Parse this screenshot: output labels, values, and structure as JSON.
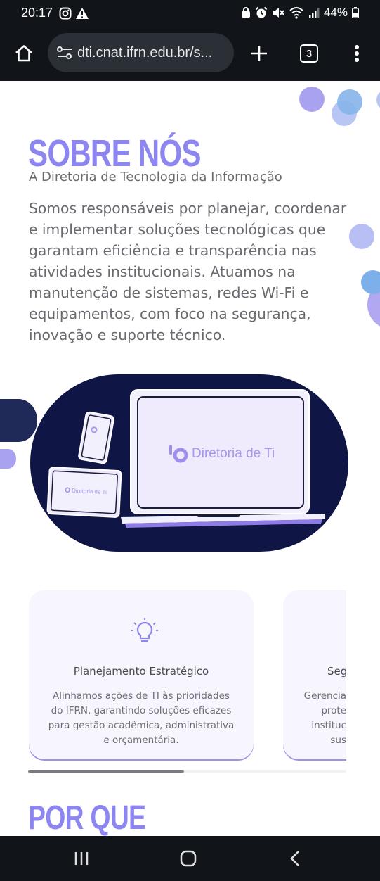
{
  "status_bar": {
    "time": "20:17",
    "battery": "44%"
  },
  "browser": {
    "url": "dti.cnat.ifrn.edu.br/s...",
    "tab_count": "3"
  },
  "about": {
    "title": "SOBRE NÓS",
    "subtitle": "A Diretoria de Tecnologia da Informação",
    "lines": [
      "Somos responsáveis por planejar, coordenar",
      "e implementar soluções tecnológicas que",
      "garantam eficiência e transparência nas",
      "atividades institucionais. Atuamos na",
      "manutenção de sistemas, redes Wi-Fi e",
      "equipamentos, com foco na segurança,",
      "inovação e suporte técnico."
    ]
  },
  "hero": {
    "brand": "Diretoria de Ti"
  },
  "cards": [
    {
      "title": "Planejamento Estratégico",
      "lines": [
        "Alinhamos ações de TI às prioridades",
        "do IFRN, garantindo soluções eficazes",
        "para gestão acadêmica, administrativa",
        "e orçamentária."
      ]
    },
    {
      "title": "Seg",
      "lines": [
        "Gerencia",
        "prote",
        "instituc",
        "sus"
      ]
    }
  ],
  "why": {
    "title": "POR QUE EXISTIMOS?"
  },
  "colors": {
    "accent": "#8d86f0",
    "dark_navy": "#0f1645",
    "bubble_blue": "#7fb0ec",
    "text_gray": "#6a6970"
  }
}
